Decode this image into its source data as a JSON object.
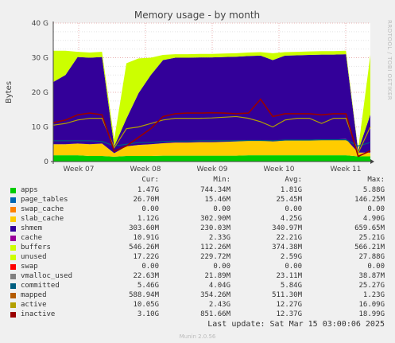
{
  "chart_data": {
    "type": "area",
    "title": "Memory usage - by month",
    "ylabel": "Bytes",
    "xlabel": "",
    "ylim": [
      0,
      40
    ],
    "y_unit": "G",
    "yticks": [
      "0",
      "10 G",
      "20 G",
      "30 G",
      "40 G"
    ],
    "xticks": [
      "Week 07",
      "Week 08",
      "Week 09",
      "Week 10",
      "Week 11"
    ],
    "grid": true,
    "side_label": "RRDTOOL / TOBI OETIKER",
    "legend_headers": [
      "Cur:",
      "Min:",
      "Avg:",
      "Max:"
    ],
    "series": [
      {
        "name": "apps",
        "color": "#00cc00",
        "cur": "1.47G",
        "min": "744.34M",
        "avg": "1.81G",
        "max": "5.88G"
      },
      {
        "name": "page_tables",
        "color": "#0066b3",
        "cur": "26.70M",
        "min": "15.46M",
        "avg": "25.45M",
        "max": "146.25M"
      },
      {
        "name": "swap_cache",
        "color": "#ff8000",
        "cur": "0.00",
        "min": "0.00",
        "avg": "0.00",
        "max": "0.00"
      },
      {
        "name": "slab_cache",
        "color": "#ffcc00",
        "cur": "1.12G",
        "min": "302.90M",
        "avg": "4.25G",
        "max": "4.90G"
      },
      {
        "name": "shmem",
        "color": "#330099",
        "cur": "303.60M",
        "min": "230.03M",
        "avg": "340.97M",
        "max": "659.65M"
      },
      {
        "name": "cache",
        "color": "#990099",
        "cur": "10.91G",
        "min": "2.33G",
        "avg": "22.21G",
        "max": "25.21G"
      },
      {
        "name": "buffers",
        "color": "#ccff00",
        "cur": "546.26M",
        "min": "112.26M",
        "avg": "374.38M",
        "max": "566.21M"
      },
      {
        "name": "unused",
        "color": "#ccff00",
        "cur": "17.22G",
        "min": "229.72M",
        "avg": "2.59G",
        "max": "27.88G"
      },
      {
        "name": "swap",
        "color": "#ff0000",
        "cur": "0.00",
        "min": "0.00",
        "avg": "0.00",
        "max": "0.00"
      },
      {
        "name": "vmalloc_used",
        "color": "#808080",
        "cur": "22.63M",
        "min": "21.89M",
        "avg": "23.11M",
        "max": "38.87M"
      },
      {
        "name": "committed",
        "color": "#005e80",
        "cur": "5.46G",
        "min": "4.04G",
        "avg": "5.84G",
        "max": "25.27G"
      },
      {
        "name": "mapped",
        "color": "#b35a00",
        "cur": "588.94M",
        "min": "354.26M",
        "avg": "511.30M",
        "max": "1.23G"
      },
      {
        "name": "active",
        "color": "#b3a000",
        "cur": "10.05G",
        "min": "2.43G",
        "avg": "12.27G",
        "max": "16.09G"
      },
      {
        "name": "inactive",
        "color": "#990000",
        "cur": "3.10G",
        "min": "851.66M",
        "avg": "12.37G",
        "max": "18.99G"
      }
    ],
    "samples": [
      {
        "apps": 1.8,
        "slab": 3.2,
        "cache": 18,
        "unused": 9.0,
        "committed": 6.0,
        "active": 10.5,
        "inactive": 11.2
      },
      {
        "apps": 1.8,
        "slab": 3.2,
        "cache": 20,
        "unused": 7.0,
        "committed": 6.0,
        "active": 11.0,
        "inactive": 12.0
      },
      {
        "apps": 1.8,
        "slab": 3.4,
        "cache": 25,
        "unused": 1.5,
        "committed": 6.0,
        "active": 12.0,
        "inactive": 13.5
      },
      {
        "apps": 1.6,
        "slab": 3.4,
        "cache": 25,
        "unused": 1.5,
        "committed": 6.0,
        "active": 12.5,
        "inactive": 14.0
      },
      {
        "apps": 1.6,
        "slab": 3.6,
        "cache": 25,
        "unused": 1.5,
        "committed": 5.8,
        "active": 12.5,
        "inactive": 13.5
      },
      {
        "apps": 1.4,
        "slab": 1.0,
        "cache": 2,
        "unused": 2.0,
        "committed": 4.5,
        "active": 4,
        "inactive": 3.0
      },
      {
        "apps": 1.6,
        "slab": 2.8,
        "cache": 8,
        "unused": 16.0,
        "committed": 5.0,
        "active": 9.5,
        "inactive": 4.5
      },
      {
        "apps": 1.6,
        "slab": 3.2,
        "cache": 15,
        "unused": 10.0,
        "committed": 5.5,
        "active": 10.0,
        "inactive": 7.0
      },
      {
        "apps": 1.6,
        "slab": 3.4,
        "cache": 20,
        "unused": 5.0,
        "committed": 5.5,
        "active": 11.0,
        "inactive": 9.5
      },
      {
        "apps": 1.7,
        "slab": 3.6,
        "cache": 24,
        "unused": 1.5,
        "committed": 5.8,
        "active": 12.0,
        "inactive": 13.0
      },
      {
        "apps": 1.7,
        "slab": 3.8,
        "cache": 24.5,
        "unused": 1.0,
        "committed": 5.9,
        "active": 12.5,
        "inactive": 13.8
      },
      {
        "apps": 1.7,
        "slab": 3.8,
        "cache": 24.5,
        "unused": 1.0,
        "committed": 5.9,
        "active": 12.5,
        "inactive": 14.0
      },
      {
        "apps": 1.7,
        "slab": 3.9,
        "cache": 24.5,
        "unused": 1.0,
        "committed": 6.0,
        "active": 12.5,
        "inactive": 14.0
      },
      {
        "apps": 1.7,
        "slab": 3.9,
        "cache": 24.5,
        "unused": 1.0,
        "committed": 6.0,
        "active": 12.6,
        "inactive": 14.1
      },
      {
        "apps": 1.7,
        "slab": 4.0,
        "cache": 24.5,
        "unused": 1.0,
        "committed": 6.0,
        "active": 12.8,
        "inactive": 14.0
      },
      {
        "apps": 1.7,
        "slab": 4.1,
        "cache": 24.5,
        "unused": 1.0,
        "committed": 6.0,
        "active": 13.0,
        "inactive": 13.8
      },
      {
        "apps": 1.8,
        "slab": 4.2,
        "cache": 24.5,
        "unused": 1.0,
        "committed": 6.1,
        "active": 12.5,
        "inactive": 14.0
      },
      {
        "apps": 1.8,
        "slab": 4.3,
        "cache": 24.5,
        "unused": 1.0,
        "committed": 6.1,
        "active": 11.5,
        "inactive": 18.0
      },
      {
        "apps": 1.8,
        "slab": 4.0,
        "cache": 23.5,
        "unused": 2.0,
        "committed": 6.0,
        "active": 10.0,
        "inactive": 13.0
      },
      {
        "apps": 1.8,
        "slab": 4.3,
        "cache": 24.5,
        "unused": 1.0,
        "committed": 6.2,
        "active": 12.0,
        "inactive": 13.8
      },
      {
        "apps": 1.8,
        "slab": 4.4,
        "cache": 24.5,
        "unused": 1.0,
        "committed": 6.2,
        "active": 12.5,
        "inactive": 13.8
      },
      {
        "apps": 1.8,
        "slab": 4.5,
        "cache": 24.5,
        "unused": 1.0,
        "committed": 6.2,
        "active": 12.5,
        "inactive": 13.8
      },
      {
        "apps": 1.8,
        "slab": 4.6,
        "cache": 24.5,
        "unused": 1.0,
        "committed": 6.3,
        "active": 11.0,
        "inactive": 13.5
      },
      {
        "apps": 1.8,
        "slab": 4.6,
        "cache": 24.5,
        "unused": 1.0,
        "committed": 6.3,
        "active": 12.5,
        "inactive": 13.8
      },
      {
        "apps": 1.8,
        "slab": 4.7,
        "cache": 24.5,
        "unused": 1.0,
        "committed": 6.3,
        "active": 12.5,
        "inactive": 13.8
      },
      {
        "apps": 1.5,
        "slab": 1.1,
        "cache": 0.5,
        "unused": 0.5,
        "committed": 4.5,
        "active": 2.5,
        "inactive": 1.5
      },
      {
        "apps": 1.5,
        "slab": 1.1,
        "cache": 11,
        "unused": 17.2,
        "committed": 5.5,
        "active": 10.0,
        "inactive": 3.1
      }
    ]
  },
  "last_update": "Last update: Sat Mar 15 03:00:06 2025",
  "munin_version": "Munin 2.0.56"
}
